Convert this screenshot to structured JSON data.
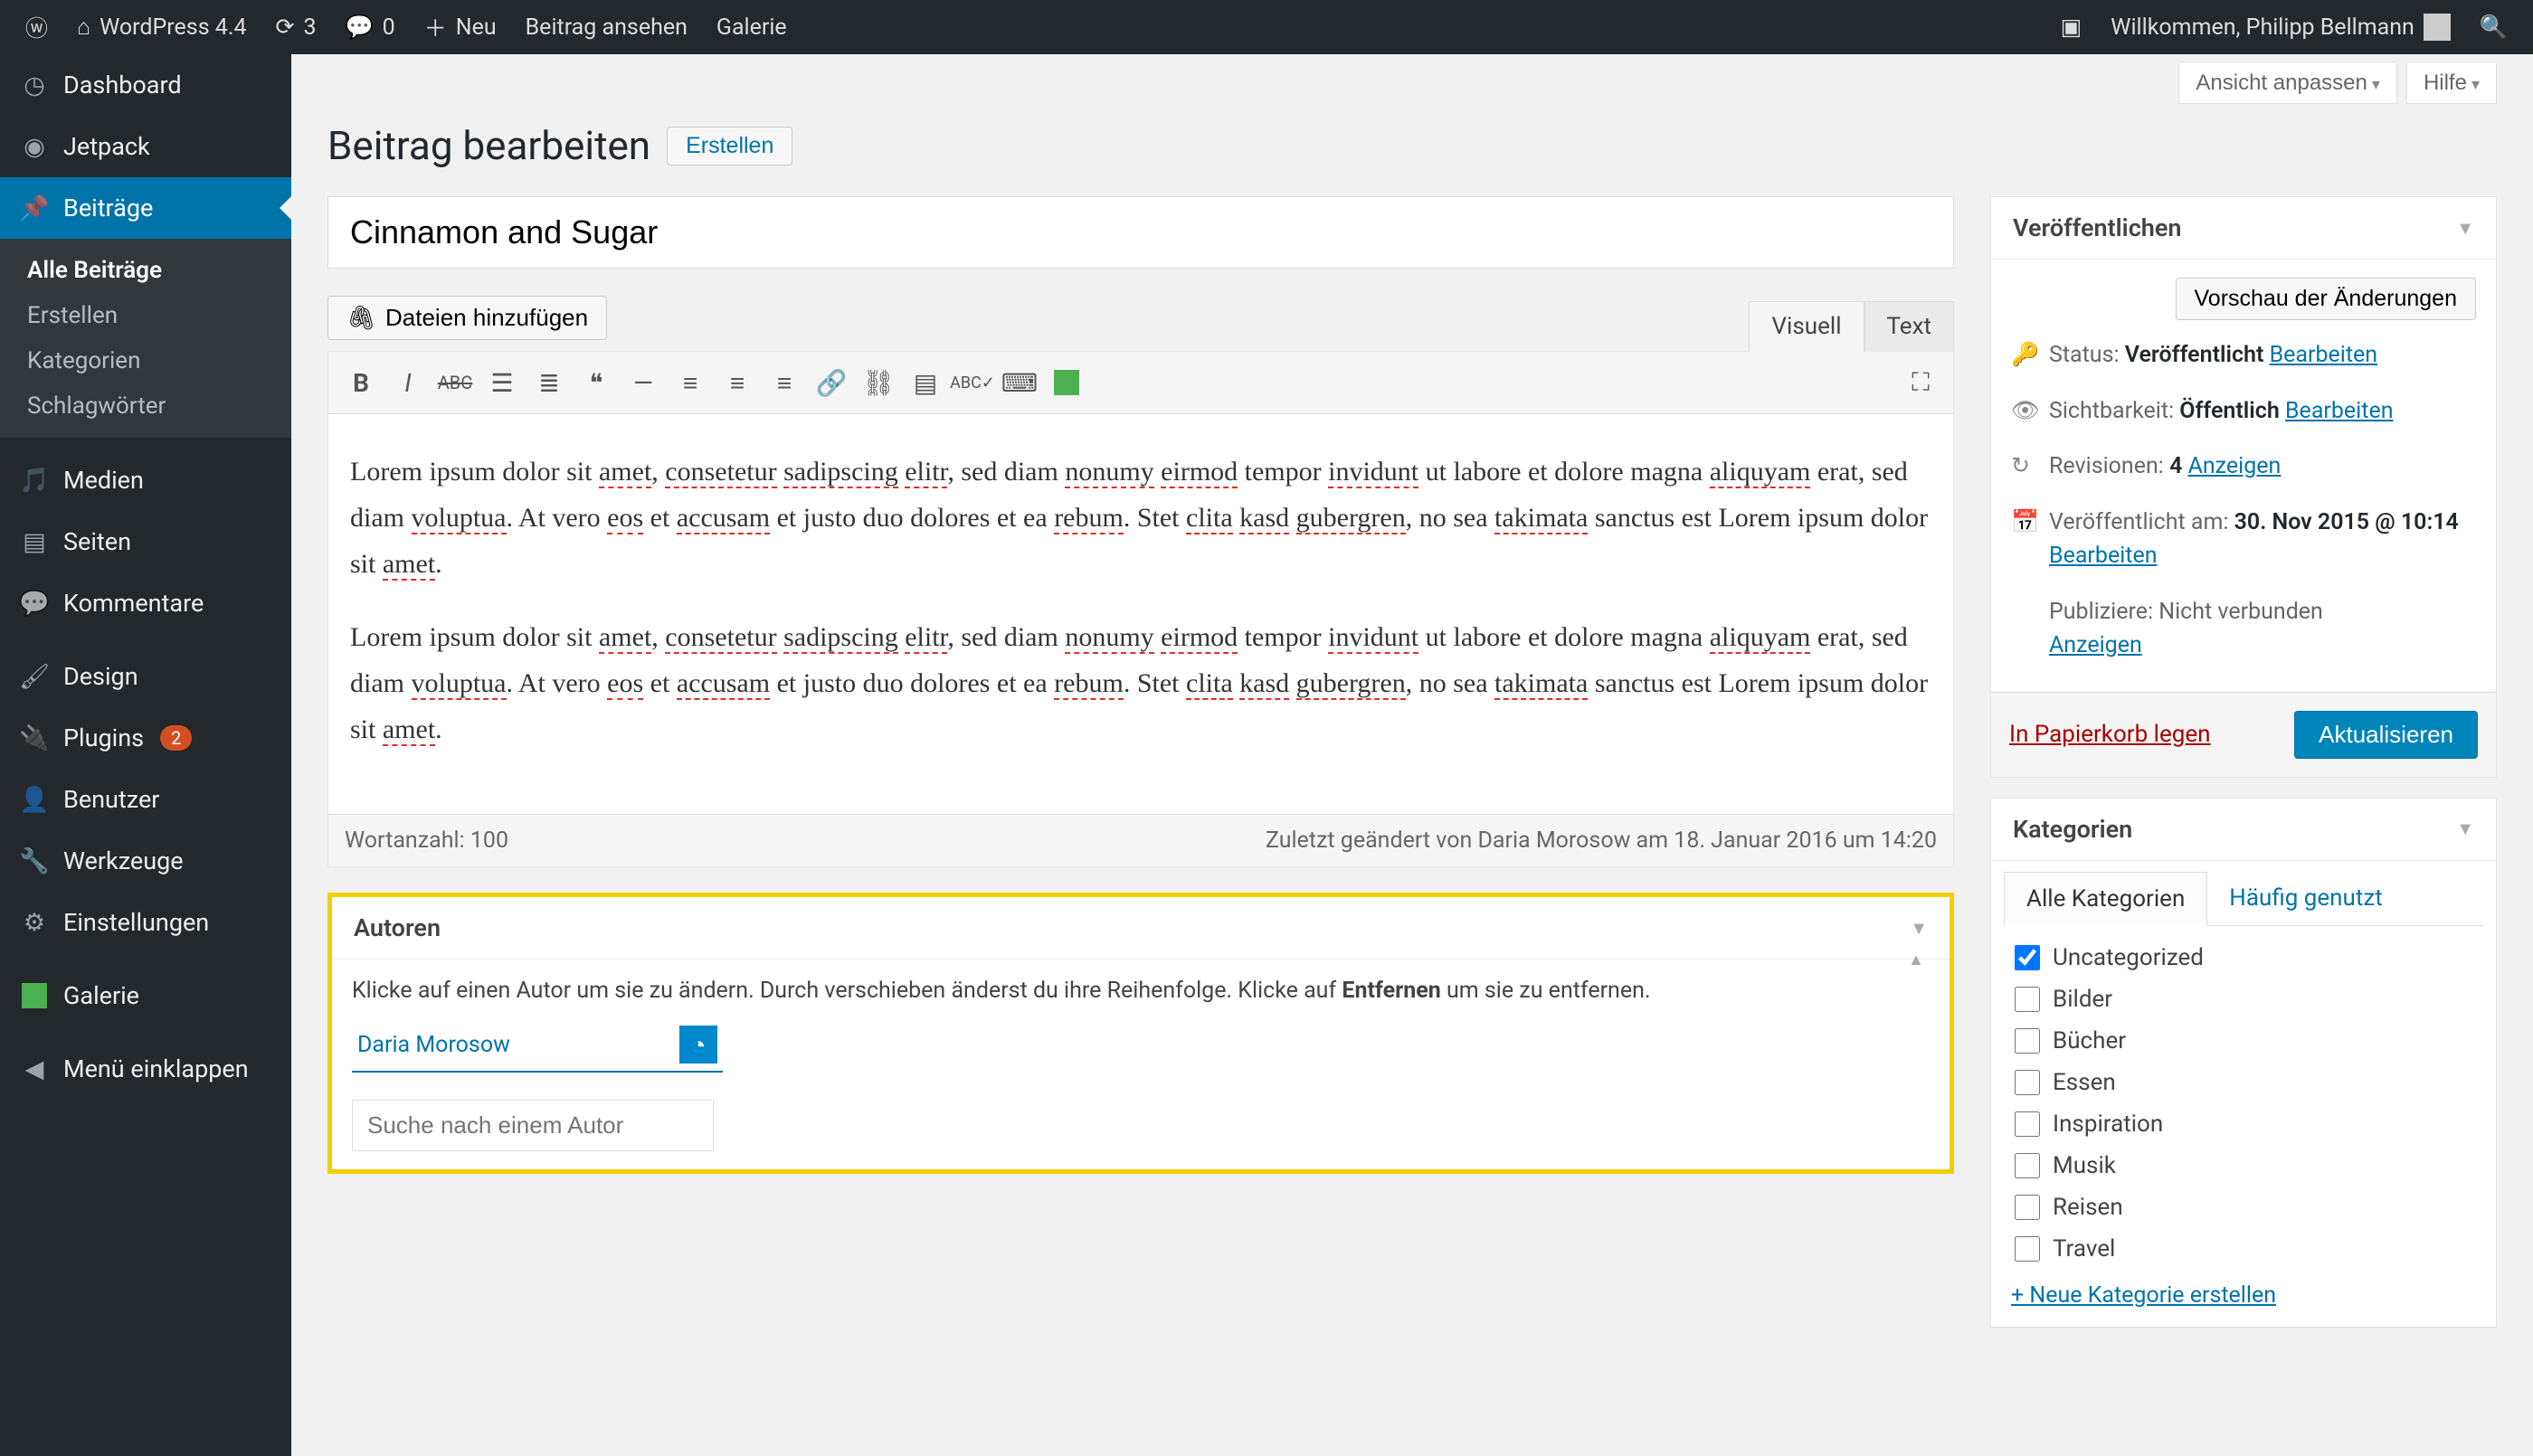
{
  "toolbar": {
    "site_name": "WordPress 4.4",
    "updates_count": "3",
    "comments_count": "0",
    "new_label": "Neu",
    "view_post": "Beitrag ansehen",
    "gallery": "Galerie",
    "howdy": "Willkommen, Philipp Bellmann"
  },
  "sidebar": {
    "items": [
      {
        "label": "Dashboard",
        "icon": "dashboard"
      },
      {
        "label": "Jetpack",
        "icon": "jetpack"
      },
      {
        "label": "Beiträge",
        "icon": "pin",
        "active": true
      },
      {
        "label": "Medien",
        "icon": "media"
      },
      {
        "label": "Seiten",
        "icon": "pages"
      },
      {
        "label": "Kommentare",
        "icon": "comments"
      },
      {
        "label": "Design",
        "icon": "appearance"
      },
      {
        "label": "Plugins",
        "icon": "plugins",
        "badge": "2"
      },
      {
        "label": "Benutzer",
        "icon": "users"
      },
      {
        "label": "Werkzeuge",
        "icon": "tools"
      },
      {
        "label": "Einstellungen",
        "icon": "settings"
      },
      {
        "label": "Galerie",
        "icon": "green"
      },
      {
        "label": "Menü einklappen",
        "icon": "collapse"
      }
    ],
    "submenu": [
      {
        "label": "Alle Beiträge",
        "current": true
      },
      {
        "label": "Erstellen"
      },
      {
        "label": "Kategorien"
      },
      {
        "label": "Schlagwörter"
      }
    ]
  },
  "screen_meta": {
    "customize": "Ansicht anpassen",
    "help": "Hilfe"
  },
  "heading": {
    "title": "Beitrag bearbeiten",
    "add_new": "Erstellen"
  },
  "post": {
    "title": "Cinnamon and Sugar",
    "paragraphs": [
      "Lorem ipsum dolor sit amet, consetetur sadipscing elitr, sed diam nonumy eirmod tempor invidunt ut labore et dolore magna aliquyam erat, sed diam voluptua. At vero eos et accusam et justo duo dolores et ea rebum. Stet clita kasd gubergren, no sea takimata sanctus est Lorem ipsum dolor sit amet.",
      "Lorem ipsum dolor sit amet, consetetur sadipscing elitr, sed diam nonumy eirmod tempor invidunt ut labore et dolore magna aliquyam erat, sed diam voluptua. At vero eos et accusam et justo duo dolores et ea rebum. Stet clita kasd gubergren, no sea takimata sanctus est Lorem ipsum dolor sit amet."
    ]
  },
  "media_button": "Dateien hinzufügen",
  "editor_tabs": {
    "visual": "Visuell",
    "text": "Text"
  },
  "editor_footer": {
    "word_count_label": "Wortanzahl: ",
    "word_count": "100",
    "last_edit": "Zuletzt geändert von Daria Morosow am 18. Januar 2016 um 14:20"
  },
  "publish": {
    "box_title": "Veröffentlichen",
    "preview": "Vorschau der Änderungen",
    "status_label": "Status:",
    "status_value": "Veröffentlicht",
    "status_edit": "Bearbeiten",
    "visibility_label": "Sichtbarkeit:",
    "visibility_value": "Öffentlich",
    "visibility_edit": "Bearbeiten",
    "revisions_label": "Revisionen:",
    "revisions_value": "4",
    "revisions_browse": "Anzeigen",
    "published_label": "Veröffentlicht am:",
    "published_value": "30. Nov 2015 @ 10:14",
    "published_edit": "Bearbeiten",
    "publicize_label": "Publiziere:",
    "publicize_value": "Nicht verbunden",
    "publicize_show": "Anzeigen",
    "trash": "In Papierkorb legen",
    "update": "Aktualisieren"
  },
  "categories": {
    "box_title": "Kategorien",
    "tabs": {
      "all": "Alle Kategorien",
      "used": "Häufig genutzt"
    },
    "items": [
      {
        "label": "Uncategorized",
        "checked": true
      },
      {
        "label": "Bilder"
      },
      {
        "label": "Bücher"
      },
      {
        "label": "Essen"
      },
      {
        "label": "Inspiration"
      },
      {
        "label": "Musik"
      },
      {
        "label": "Reisen"
      },
      {
        "label": "Travel"
      }
    ],
    "add_new": "+ Neue Kategorie erstellen"
  },
  "authors": {
    "box_title": "Autoren",
    "help_prefix": "Klicke auf einen Autor um sie zu ändern. Durch verschieben änderst du ihre Reihenfolge. Klicke auf ",
    "help_bold": "Entfernen",
    "help_suffix": " um sie zu entfernen.",
    "list": [
      {
        "name": "Daria Morosow"
      }
    ],
    "search_placeholder": "Suche nach einem Autor"
  }
}
